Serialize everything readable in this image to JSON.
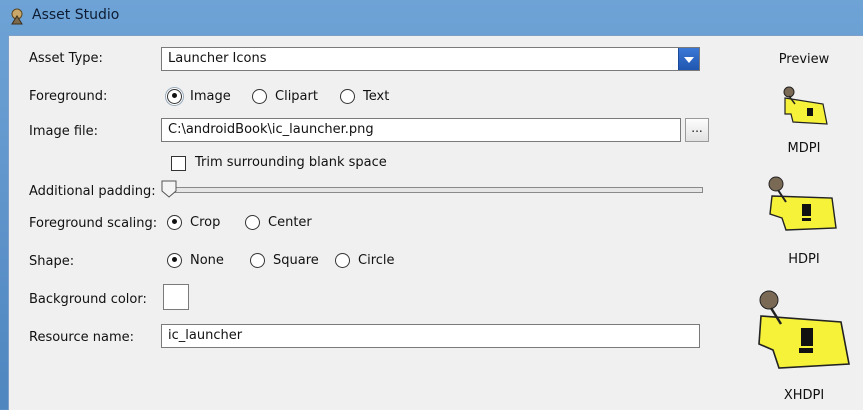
{
  "window": {
    "title": "Asset Studio"
  },
  "form": {
    "asset_type": {
      "label": "Asset Type:",
      "value": "Launcher Icons"
    },
    "foreground": {
      "label": "Foreground:",
      "options": [
        "Image",
        "Clipart",
        "Text"
      ],
      "selected": "Image"
    },
    "image_file": {
      "label": "Image file:",
      "value": "C:\\androidBook\\ic_launcher.png",
      "browse_label": "..."
    },
    "trim": {
      "label": "Trim surrounding blank space",
      "checked": false
    },
    "padding": {
      "label": "Additional padding:",
      "value_percent": 0
    },
    "foreground_scaling": {
      "label": "Foreground scaling:",
      "options": [
        "Crop",
        "Center"
      ],
      "selected": "Crop"
    },
    "shape": {
      "label": "Shape:",
      "options": [
        "None",
        "Square",
        "Circle"
      ],
      "selected": "None"
    },
    "background_color": {
      "label": "Background color:",
      "color": "#ffffff"
    },
    "resource_name": {
      "label": "Resource name:",
      "value": "ic_launcher"
    }
  },
  "preview": {
    "title": "Preview",
    "densities": [
      "MDPI",
      "HDPI",
      "XHDPI"
    ]
  },
  "colors": {
    "titlebar": "#5a8fc4",
    "note_yellow": "#f6f23a",
    "dropdown_accent": "#2a63c2"
  }
}
